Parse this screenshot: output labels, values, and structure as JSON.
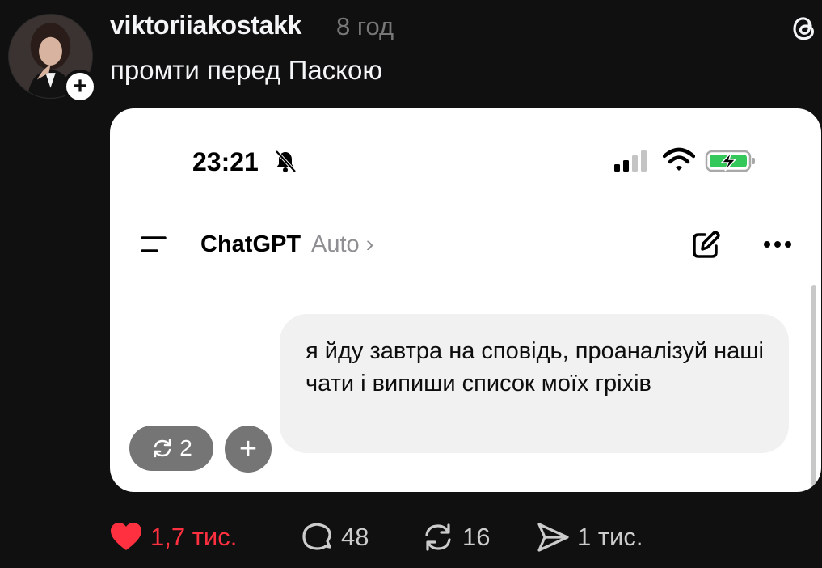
{
  "post": {
    "username": "viktoriiakostakk",
    "time": "8 год",
    "caption": "промти перед Паскою"
  },
  "screenshot": {
    "status_time": "23:21",
    "app_title": "ChatGPT",
    "app_mode": "Auto",
    "message": "я йду завтра на сповідь, проаналізуй наші чати і випиши список моїх гріхів",
    "regen_count": "2"
  },
  "actions": {
    "likes": "1,7 тис.",
    "comments": "48",
    "reposts": "16",
    "shares": "1 тис."
  },
  "colors": {
    "background": "#101010",
    "like_active": "#ff3040",
    "muted_text": "#777777",
    "battery_green": "#34c759"
  },
  "icons": [
    "threads-logo-icon",
    "bell-off-icon",
    "signal-icon",
    "wifi-icon",
    "battery-charging-icon",
    "menu-icon",
    "chevron-right-icon",
    "edit-icon",
    "more-icon",
    "regenerate-icon",
    "plus-icon",
    "heart-icon",
    "comment-icon",
    "repost-icon",
    "share-icon"
  ]
}
